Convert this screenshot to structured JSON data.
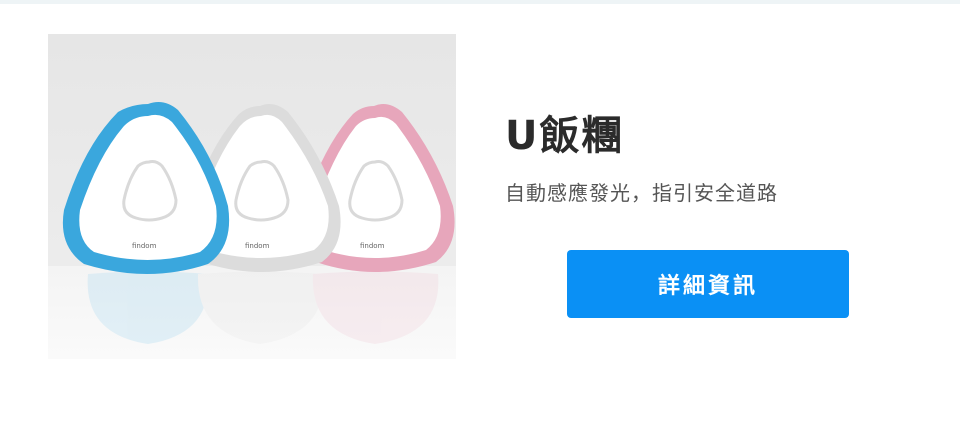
{
  "product": {
    "title": "U飯糰",
    "description": "自動感應發光，指引安全道路",
    "button_label": "詳細資訊",
    "image": {
      "alt": "三款三角形夜燈（藍、白、粉）",
      "brand_mark": "findom",
      "variants": [
        {
          "name": "blue",
          "color": "#3aa7dd"
        },
        {
          "name": "white",
          "color": "#e8e8e8"
        },
        {
          "name": "pink",
          "color": "#e7a6bb"
        }
      ]
    }
  },
  "colors": {
    "button": "#0a90f5",
    "title": "#2b2b2b",
    "description": "#555555"
  }
}
